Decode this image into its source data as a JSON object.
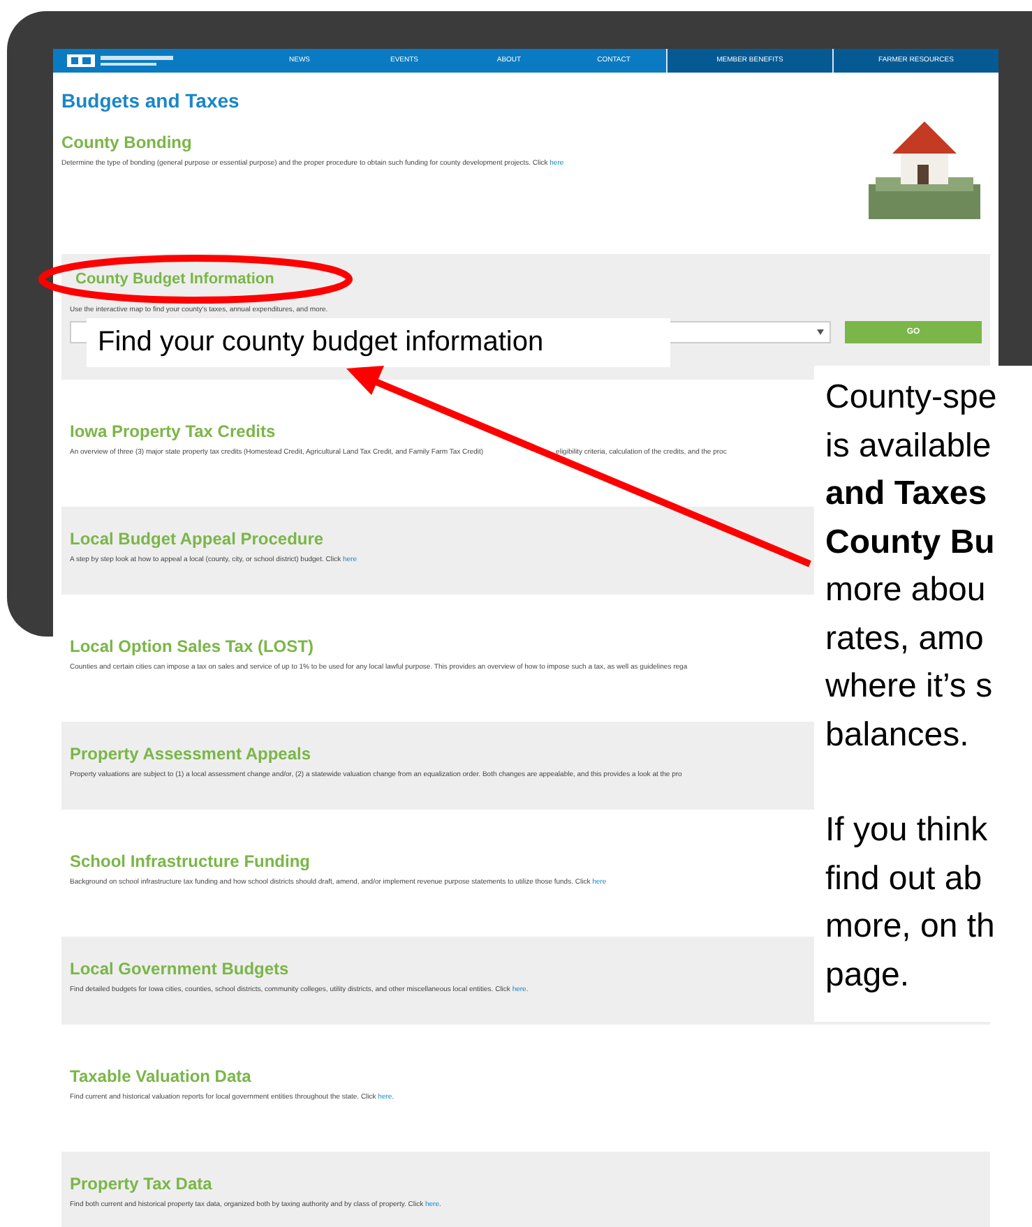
{
  "nav": [
    {
      "label": "NEWS",
      "highlighted": false
    },
    {
      "label": "EVENTS",
      "highlighted": false
    },
    {
      "label": "ABOUT",
      "highlighted": false
    },
    {
      "label": "CONTACT",
      "highlighted": false
    },
    {
      "label": "MEMBER BENEFITS",
      "highlighted": true
    },
    {
      "label": "FARMER RESOURCES",
      "highlighted": true
    }
  ],
  "page_title": "Budgets and Taxes",
  "intro": {
    "title": "County Bonding",
    "text": "Determine the type of bonding (general purpose or essential purpose) and the proper procedure to obtain such funding for county development projects. Click ",
    "link": "here"
  },
  "budget_info": {
    "title": "County Budget Information",
    "text": "Use the interactive map to find your county's taxes, annual expenditures, and more.",
    "button": "GO"
  },
  "sections": [
    {
      "title": "Iowa Property Tax Credits",
      "shaded": false,
      "text": "An overview of three (3) major state property tax credits (Homestead Credit, Agricultural Land Tax Credit, and Family Farm Tax Credit)",
      "text_2": "eligibility criteria, calculation of the credits, and the proc"
    },
    {
      "title": "Local Budget Appeal Procedure",
      "shaded": true,
      "text": "A step by step look at how to appeal a local (county, city, or school district) budget. Click ",
      "link": "here"
    },
    {
      "title": "Local Option Sales Tax (LOST)",
      "shaded": false,
      "text": "Counties and certain cities can impose a tax on sales and service of up to 1% to be used for any local lawful purpose. This provides an overview of how to impose such a tax, as well as guidelines rega"
    },
    {
      "title": "Property Assessment Appeals",
      "shaded": true,
      "text": "Property valuations are subject to (1) a local assessment change and/or, (2) a statewide valuation change from an equalization order. Both changes are appealable, and this provides a look at the pro"
    },
    {
      "title": "School Infrastructure Funding",
      "shaded": false,
      "text": "Background on school infrastructure tax funding and how school districts should draft, amend, and/or implement revenue purpose statements to utilize those funds. Click ",
      "link": "here"
    },
    {
      "title": "Local Government Budgets",
      "shaded": true,
      "text": "Find detailed budgets for Iowa cities, counties, school districts, community colleges, utility districts, and other miscellaneous local entities. Click ",
      "link": "here",
      "after": "."
    },
    {
      "title": "Taxable Valuation Data",
      "shaded": false,
      "text": "Find current and historical valuation reports for local government entities throughout the state. Click ",
      "link": "here",
      "after": "."
    },
    {
      "title": "Property Tax Data",
      "shaded": true,
      "text": "Find both current and historical property tax data, organized both by taxing authority and by class of property. Click ",
      "link": "here",
      "after": "."
    }
  ],
  "label": "Find your county budget information",
  "callout": [
    [
      "County-spe",
      "is available",
      "**and Taxes**",
      "**County Bu**",
      "more abou",
      "rates, amo",
      "where it’s s",
      "balances."
    ],
    [
      "If you think",
      "find out ab",
      "more, on th",
      "page."
    ]
  ]
}
